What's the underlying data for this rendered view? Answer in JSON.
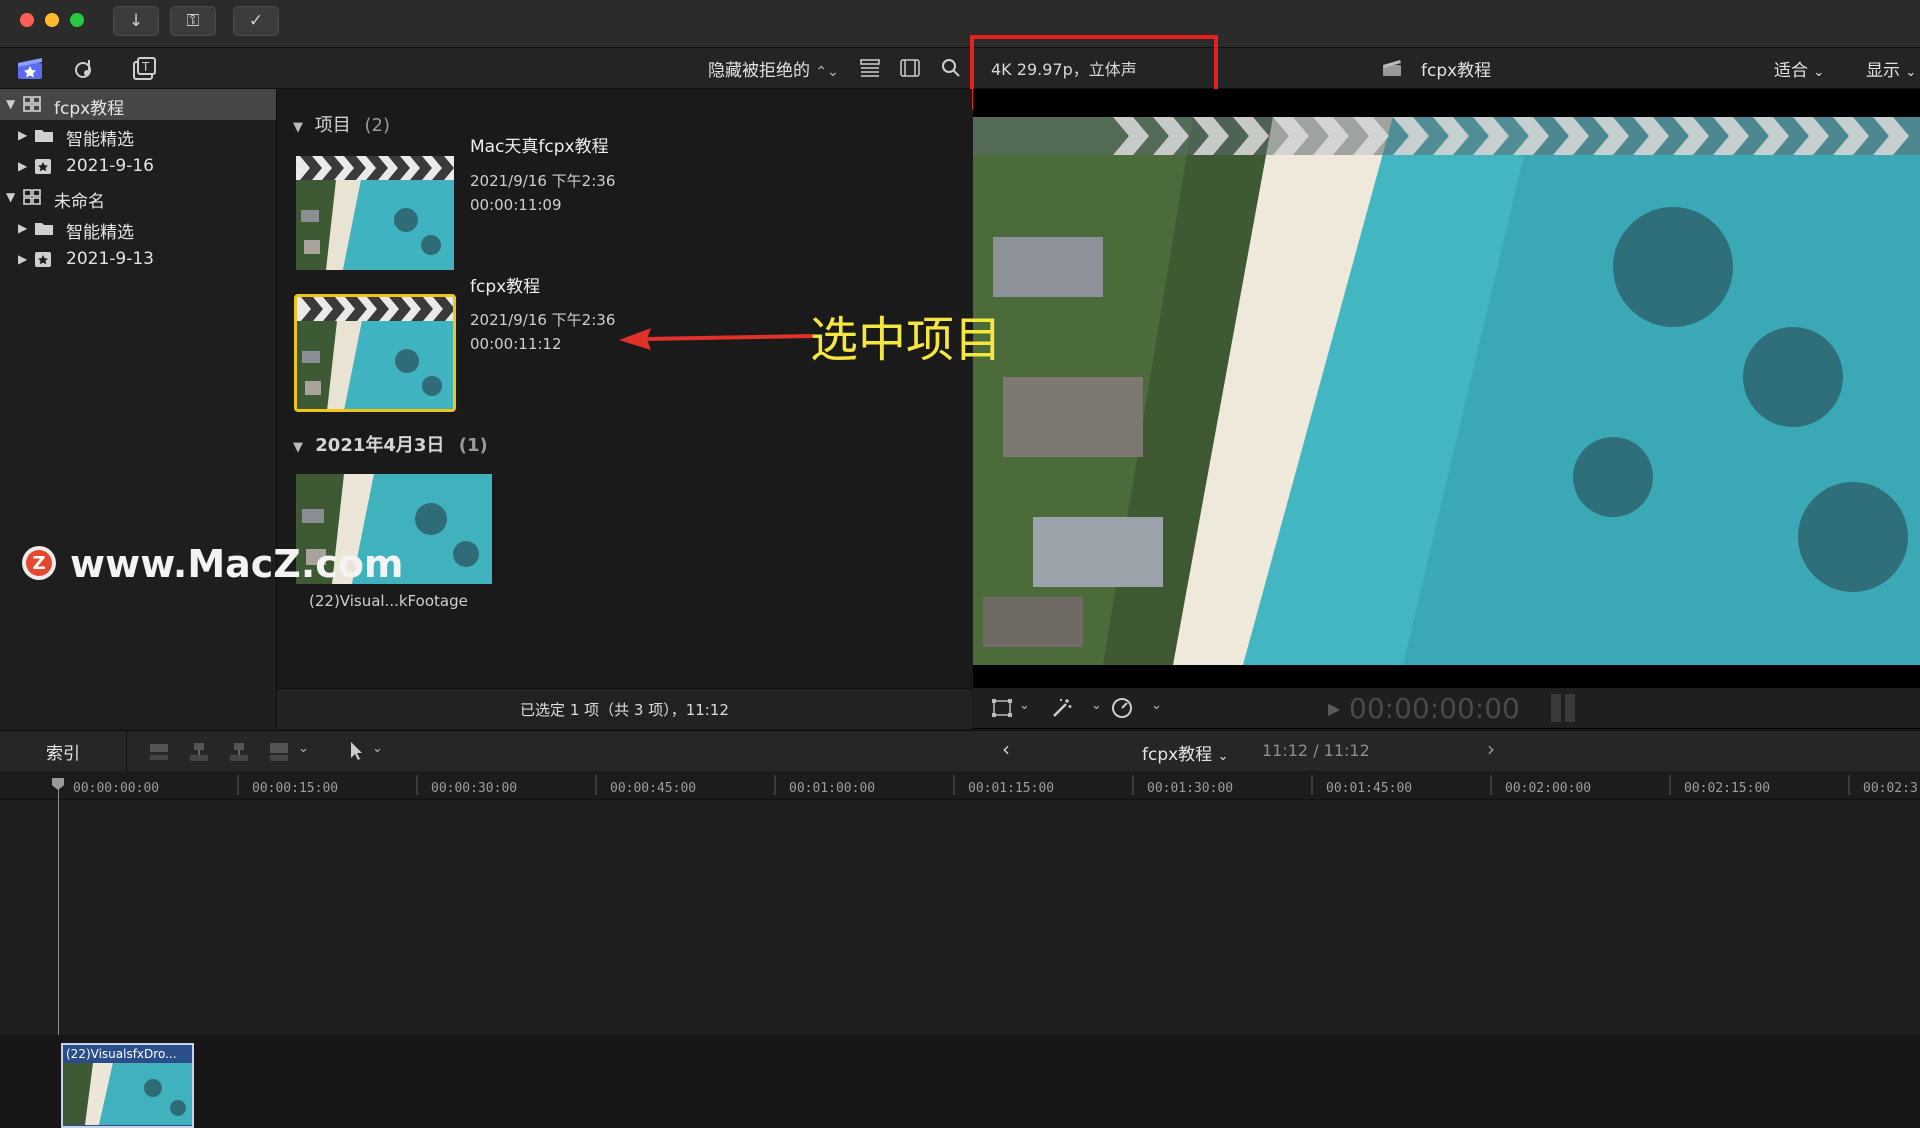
{
  "window": {
    "traffic_colors": [
      "#ff5f57",
      "#febc2e",
      "#28c840"
    ],
    "toolbar_buttons": [
      "import-icon",
      "keywords-icon",
      "check-icon"
    ]
  },
  "toolbar": {
    "filter_label": "隐藏被拒绝的",
    "viewer_format": "4K 29.97p，立体声",
    "viewer_title": "fcpx教程",
    "zoom_label": "适合",
    "display_label": "显示"
  },
  "sidebar": {
    "items": [
      {
        "label": "fcpx教程",
        "kind": "library",
        "selected": true
      },
      {
        "label": "智能精选",
        "kind": "folder"
      },
      {
        "label": "2021-9-16",
        "kind": "event"
      },
      {
        "label": "未命名",
        "kind": "library"
      },
      {
        "label": "智能精选",
        "kind": "folder"
      },
      {
        "label": "2021-9-13",
        "kind": "event"
      }
    ]
  },
  "browser": {
    "section_projects": "项目",
    "section_projects_count": "(2)",
    "projects": [
      {
        "title": "Mac天真fcpx教程",
        "date": "2021/9/16 下午2:36",
        "duration": "00:00:11:09"
      },
      {
        "title": "fcpx教程",
        "date": "2021/9/16 下午2:36",
        "duration": "00:00:11:12",
        "selected": true
      }
    ],
    "section_date": "2021年4月3日",
    "section_date_count": "(1)",
    "clip_label": "(22)Visual...kFootage",
    "status": "已选定 1 项（共 3 项），11:12",
    "highlight_color": "#f0c419"
  },
  "viewer": {
    "timecode": "00:00:00:00"
  },
  "timeline": {
    "index_label": "索引",
    "project_name": "fcpx教程",
    "duration": "11:12 / 11:12",
    "ticks": [
      "00:00:00:00",
      "00:00:15:00",
      "00:00:30:00",
      "00:00:45:00",
      "00:01:00:00",
      "00:01:15:00",
      "00:01:30:00",
      "00:01:45:00",
      "00:02:00:00",
      "00:02:15:00",
      "00:02:3"
    ],
    "clip_title": "(22)VisualsfxDro..."
  },
  "annotation": {
    "text": "选中项目",
    "color": "#f5e640",
    "arrow_color": "#e0322a",
    "box_color": "#e5221d"
  },
  "watermark": {
    "text": "www.MacZ.com"
  }
}
